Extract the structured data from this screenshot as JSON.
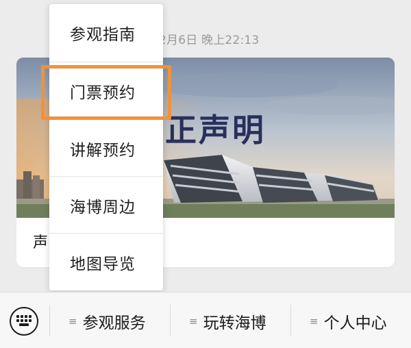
{
  "post": {
    "timestamp": "2月6日 晚上22:13",
    "banner_title": "严正声明",
    "caption": "声"
  },
  "menu": {
    "items": [
      {
        "label": "参观指南"
      },
      {
        "label": "门票预约"
      },
      {
        "label": "讲解预约"
      },
      {
        "label": "海博周边"
      },
      {
        "label": "地图导览"
      }
    ],
    "highlighted_index": 1
  },
  "tabbar": {
    "keyboard_icon": "keyboard-icon",
    "tabs": [
      {
        "label": "参观服务",
        "icon": "menu-lines-icon"
      },
      {
        "label": "玩转海博",
        "icon": "menu-lines-icon"
      },
      {
        "label": "个人中心",
        "icon": "menu-lines-icon"
      }
    ]
  },
  "colors": {
    "highlight": "#f0923a",
    "banner_title": "#28305a",
    "background": "#ececec"
  }
}
